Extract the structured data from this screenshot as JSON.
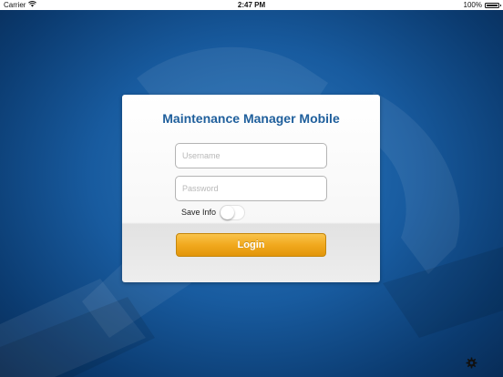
{
  "status_bar": {
    "carrier": "Carrier",
    "time": "2:47 PM",
    "battery": "100%"
  },
  "login": {
    "title": "Maintenance Manager Mobile",
    "username_placeholder": "Username",
    "username_value": "",
    "password_placeholder": "Password",
    "password_value": "",
    "save_info_label": "Save Info",
    "save_info_enabled": false,
    "login_button_label": "Login"
  },
  "icons": {
    "wifi": "wifi-icon",
    "battery": "battery-icon",
    "settings": "gear-icon"
  },
  "colors": {
    "title": "#1f5f9c",
    "background": "#185b9f",
    "login_button": "#f1a91e"
  }
}
